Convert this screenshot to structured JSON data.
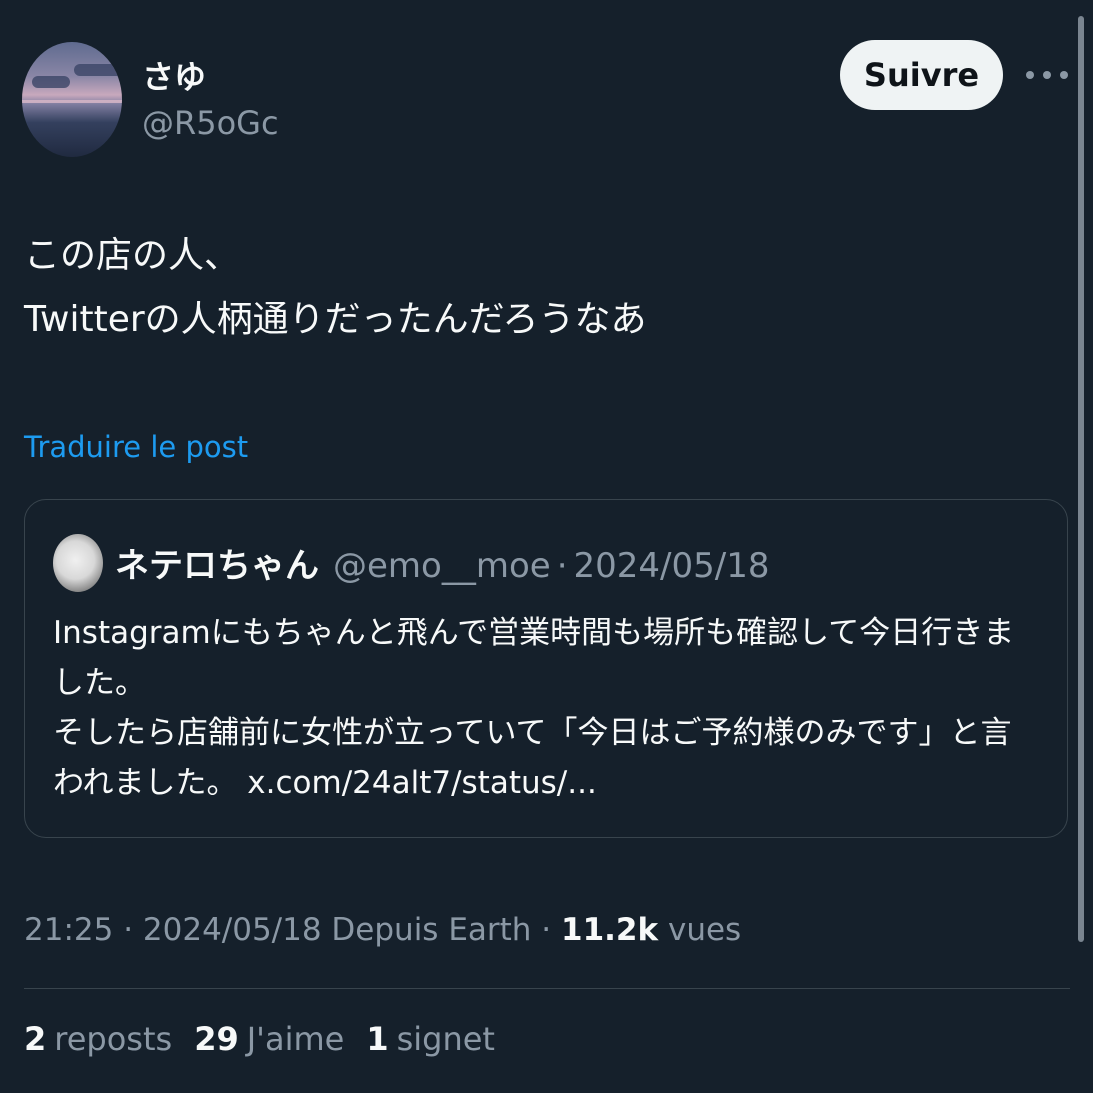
{
  "author": {
    "display_name": "さゆ",
    "handle": "@R5oGc",
    "follow_label": "Suivre",
    "more_icon": "more-horizontal-icon"
  },
  "tweet": {
    "lines": [
      "この店の人、",
      "Twitterの人柄通りだったんだろうなあ"
    ],
    "translate_label": "Traduire le post"
  },
  "quote": {
    "display_name": "ネテロちゃん",
    "handle": "@emo__moe",
    "separator": "·",
    "date": "2024/05/18",
    "lines": [
      "Instagramにもちゃんと飛んで営業時間も場所も確認して今日行きま",
      "した。",
      "そしたら店舗前に女性が立っていて「今日はご予約様のみです」と言",
      "われました。 x.com/24alt7/status/..."
    ]
  },
  "meta": {
    "time_and_source": "21:25 · 2024/05/18 Depuis Earth · ",
    "views_count": "11.2k",
    "views_label": " vues"
  },
  "stats": [
    {
      "count": "2",
      "label": "reposts"
    },
    {
      "count": "29",
      "label": "J'aime"
    },
    {
      "count": "1",
      "label": "signet"
    }
  ],
  "colors": {
    "background": "#15202b",
    "link": "#1d9bf0",
    "secondary_text": "#8b98a5",
    "primary_text": "#f7f9f9",
    "border": "#38444d"
  }
}
